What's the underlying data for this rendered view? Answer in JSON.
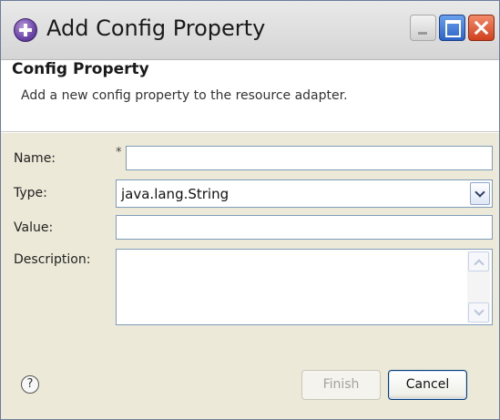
{
  "window": {
    "title": "Add Config Property",
    "icon": "eclipse-plus-icon",
    "controls": [
      "minimize-icon",
      "maximize-icon",
      "close-icon"
    ]
  },
  "banner": {
    "title": "Config Property",
    "description": "Add a new config property to the resource adapter."
  },
  "form": {
    "name": {
      "label": "Name:",
      "required_mark": "*",
      "value": ""
    },
    "type": {
      "label": "Type:",
      "value": "java.lang.String"
    },
    "value": {
      "label": "Value:",
      "value": ""
    },
    "description": {
      "label": "Description:",
      "value": ""
    }
  },
  "footer": {
    "help_glyph": "?",
    "finish_label": "Finish",
    "cancel_label": "Cancel"
  },
  "colors": {
    "dialog_bg": "#ece9d8",
    "field_border": "#7f9db9",
    "disabled_text": "#a6a39a",
    "close_button": "#d0411e",
    "maximize_button": "#2d63c8"
  }
}
